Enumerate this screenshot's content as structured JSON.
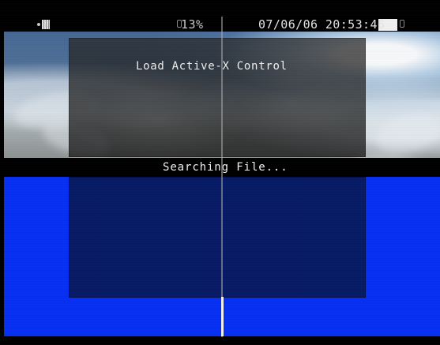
{
  "screen": {
    "status": {
      "percentage": "13%",
      "datetime": "07/06/06 20:53:46"
    },
    "dialog": {
      "title": "Load Active-X Control"
    },
    "progress": {
      "message": "Searching File..."
    }
  },
  "icons": {
    "camera": "camera-icon",
    "small_marker": "marker-icon"
  },
  "colors": {
    "background": "#000000",
    "blue_area": "#0630f4",
    "blue_panel": "#071a65",
    "text": "#f0f0f0"
  }
}
